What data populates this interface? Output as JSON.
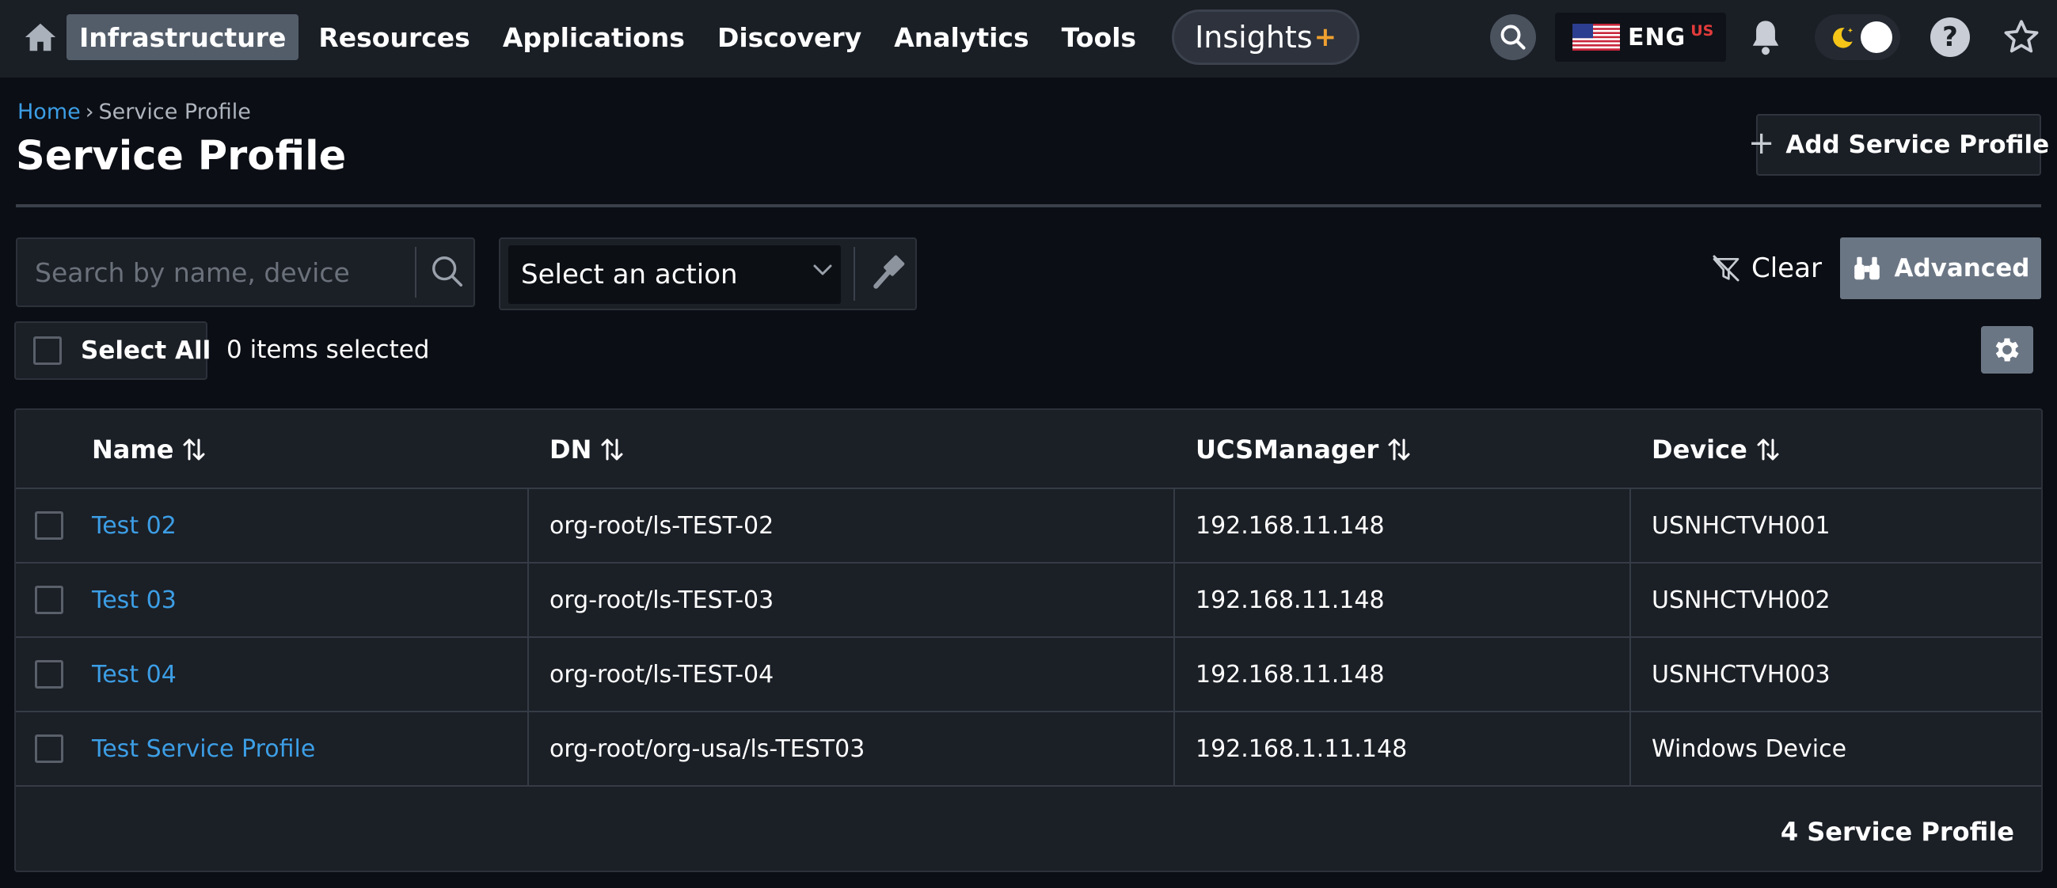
{
  "nav": {
    "items": [
      {
        "label": "Infrastructure",
        "active": true
      },
      {
        "label": "Resources",
        "active": false
      },
      {
        "label": "Applications",
        "active": false
      },
      {
        "label": "Discovery",
        "active": false
      },
      {
        "label": "Analytics",
        "active": false
      },
      {
        "label": "Tools",
        "active": false
      }
    ],
    "insights_label": "Insights",
    "insights_suffix": "+",
    "language_code": "ENG",
    "language_region": "US",
    "help_label": "?",
    "icons": [
      "home-icon",
      "search-icon",
      "us-flag-icon",
      "bell-icon",
      "moon-icon",
      "help-icon",
      "star-icon"
    ]
  },
  "breadcrumb": {
    "home": "Home",
    "separator": "›",
    "current": "Service Profile"
  },
  "page": {
    "title": "Service Profile",
    "add_button_icon": "+",
    "add_button_label": "Add Service Profile"
  },
  "toolbar": {
    "search_placeholder": "Search by name, device",
    "search_value": "",
    "action_placeholder": "Select an action",
    "clear_label": "Clear",
    "advanced_label": "Advanced",
    "select_all_label": "Select All",
    "items_selected": "0 items selected"
  },
  "table": {
    "columns": [
      {
        "label": "Name",
        "sortable": true
      },
      {
        "label": "DN",
        "sortable": true
      },
      {
        "label": "UCSManager",
        "sortable": true
      },
      {
        "label": "Device",
        "sortable": true
      }
    ],
    "rows": [
      {
        "name": "Test 02",
        "dn": "org-root/ls-TEST-02",
        "ucsmanager": "192.168.11.148",
        "device": "USNHCTVH001",
        "checked": false
      },
      {
        "name": "Test 03",
        "dn": "org-root/ls-TEST-03",
        "ucsmanager": "192.168.11.148",
        "device": "USNHCTVH002",
        "checked": false
      },
      {
        "name": "Test 04",
        "dn": "org-root/ls-TEST-04",
        "ucsmanager": "192.168.11.148",
        "device": "USNHCTVH003",
        "checked": false
      },
      {
        "name": "Test Service Profile",
        "dn": "org-root/org-usa/ls-TEST03",
        "ucsmanager": "192.168.1.11.148",
        "device": "Windows Device",
        "checked": false
      }
    ],
    "footer": "4 Service Profile"
  },
  "colors": {
    "background": "#0b0e14",
    "nav_background": "#1a1e25",
    "active_nav": "#535d6a",
    "link": "#3c9ee5",
    "accent_plus": "#f0a030",
    "button_gray": "#6b7685"
  }
}
